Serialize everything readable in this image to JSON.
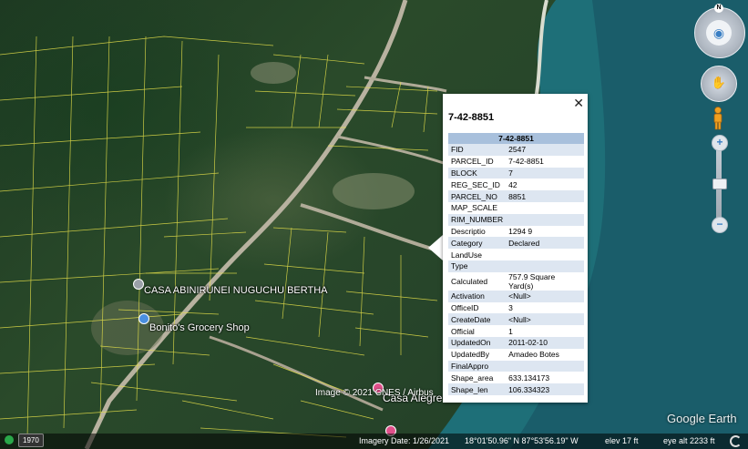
{
  "map": {
    "labels": {
      "casa_abinirunei": "CASA ABINIRUNEI NUGUCHU BERTHA",
      "bonitos": "Bonito's Grocery Shop",
      "casa_alegre": "Casa Alegre"
    },
    "copyright": "Image © 2021 CNES / Airbus",
    "watermark": "Google Earth"
  },
  "popup": {
    "title": "7-42-8851",
    "table_header": "7-42-8851",
    "close_label": "✕",
    "rows": [
      {
        "key": "FID",
        "value": "2547"
      },
      {
        "key": "PARCEL_ID",
        "value": "7-42-8851"
      },
      {
        "key": "BLOCK",
        "value": "7"
      },
      {
        "key": "REG_SEC_ID",
        "value": "42"
      },
      {
        "key": "PARCEL_NO",
        "value": "8851"
      },
      {
        "key": "MAP_SCALE",
        "value": ""
      },
      {
        "key": "RIM_NUMBER",
        "value": ""
      },
      {
        "key": "Descriptio",
        "value": "1294 9"
      },
      {
        "key": "Category",
        "value": "Declared"
      },
      {
        "key": "LandUse",
        "value": ""
      },
      {
        "key": "Type",
        "value": ""
      },
      {
        "key": "Calculated",
        "value": "757.9 Square Yard(s)"
      },
      {
        "key": "Activation",
        "value": "<Null>"
      },
      {
        "key": "OfficeID",
        "value": "3"
      },
      {
        "key": "CreateDate",
        "value": "<Null>"
      },
      {
        "key": "Official",
        "value": "1"
      },
      {
        "key": "UpdatedOn",
        "value": "2011-02-10"
      },
      {
        "key": "UpdatedBy",
        "value": "Amadeo Botes"
      },
      {
        "key": "FinalAppro",
        "value": ""
      },
      {
        "key": "Shape_area",
        "value": "633.134173"
      },
      {
        "key": "Shape_len",
        "value": "106.334323"
      }
    ]
  },
  "nav": {
    "compass_north": "N",
    "zoom_in": "+",
    "zoom_out": "−"
  },
  "status": {
    "year": "1970",
    "imagery_date": "Imagery Date: 1/26/2021",
    "coords": "18°01'50.96\" N  87°53'56.19\" W",
    "elev": "elev   17 ft",
    "eye_alt": "eye alt  2233 ft"
  },
  "colors": {
    "parcel_lines": "#e8e24a",
    "popup_header": "#a8c0dc",
    "row_stripe": "#dde6f1"
  }
}
